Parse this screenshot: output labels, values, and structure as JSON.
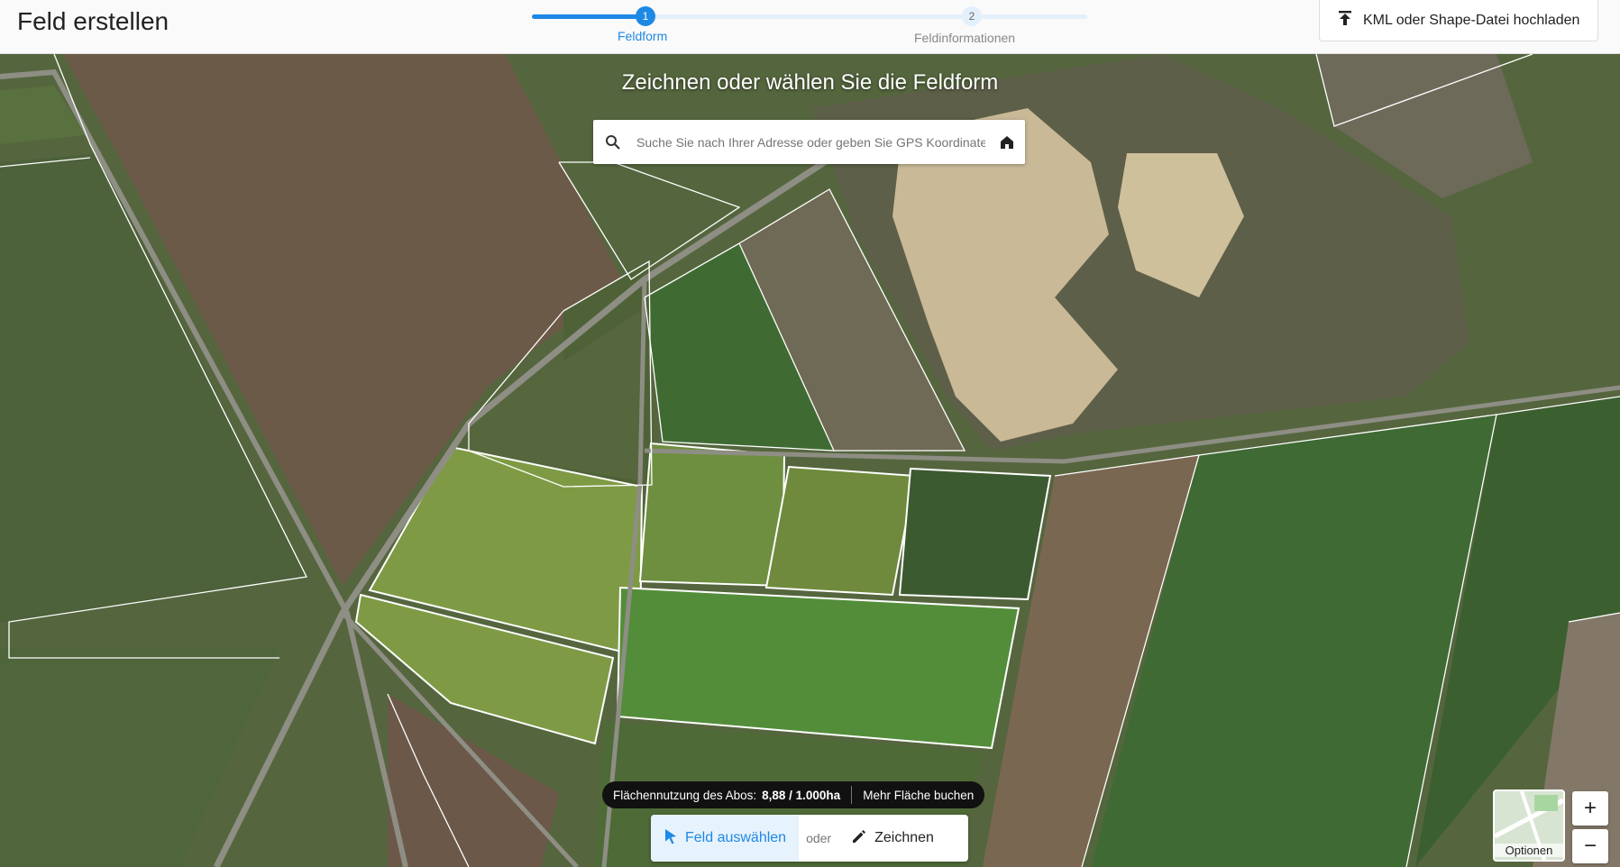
{
  "header": {
    "title": "Feld erstellen",
    "steps": [
      {
        "number": "1",
        "label": "Feldform",
        "state": "active"
      },
      {
        "number": "2",
        "label": "Feldinformationen",
        "state": "inactive"
      }
    ],
    "upload_label": "KML oder Shape-Datei hochladen"
  },
  "map": {
    "heading": "Zeichnen oder wählen Sie die Feldform",
    "search_placeholder": "Suche Sie nach Ihrer Adresse oder geben Sie GPS Koordinaten ein",
    "usage_label": "Flächennutzung des Abos:",
    "usage_value": "8,88 / 1.000ha",
    "buy_label": "Mehr Fläche buchen",
    "mode_select_label": "Feld auswählen",
    "mode_or_label": "oder",
    "mode_draw_label": "Zeichnen",
    "zoom_in_label": "+",
    "zoom_out_label": "−",
    "options_label": "Optionen"
  },
  "colors": {
    "accent": "#1e88e5",
    "selected_field": "#8aa84f"
  },
  "icons": [
    "upload-icon",
    "search-icon",
    "home-icon",
    "cursor-icon",
    "pencil-icon"
  ]
}
